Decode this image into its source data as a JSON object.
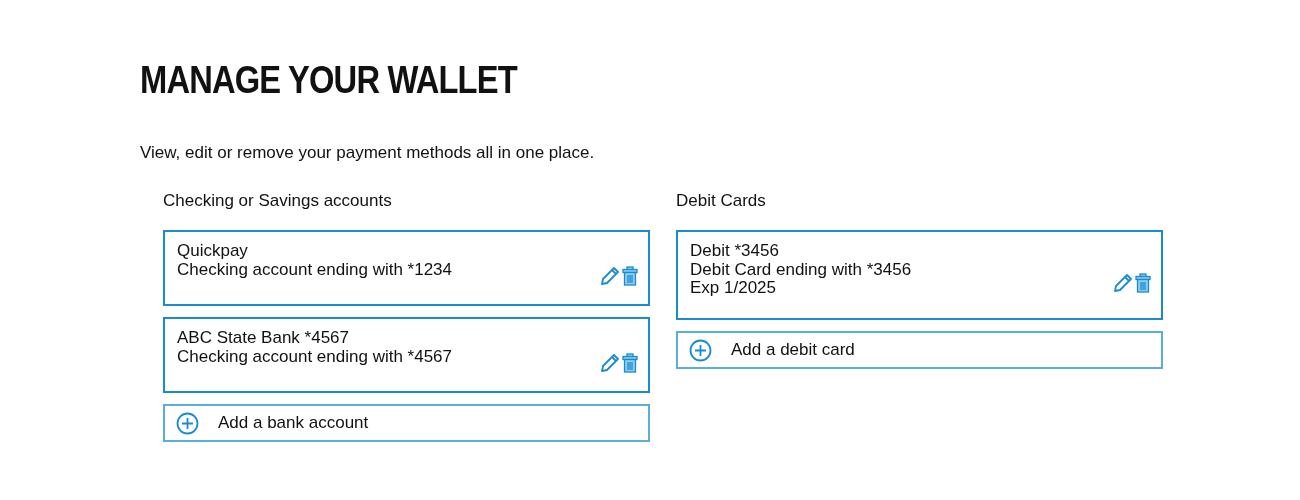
{
  "title": "MANAGE YOUR WALLET",
  "subtitle": "View, edit or remove your payment methods all in one place.",
  "sections": [
    {
      "heading": "Checking or Savings accounts",
      "items": [
        {
          "lines": [
            "Quickpay",
            "Checking account ending with *1234"
          ]
        },
        {
          "lines": [
            "ABC State Bank *4567",
            "Checking account ending with *4567"
          ]
        }
      ],
      "add_label": "Add a bank account"
    },
    {
      "heading": "Debit Cards",
      "items": [
        {
          "lines": [
            "Debit *3456",
            "Debit Card ending with *3456",
            "Exp 1/2025"
          ]
        }
      ],
      "add_label": "Add a debit card"
    }
  ]
}
